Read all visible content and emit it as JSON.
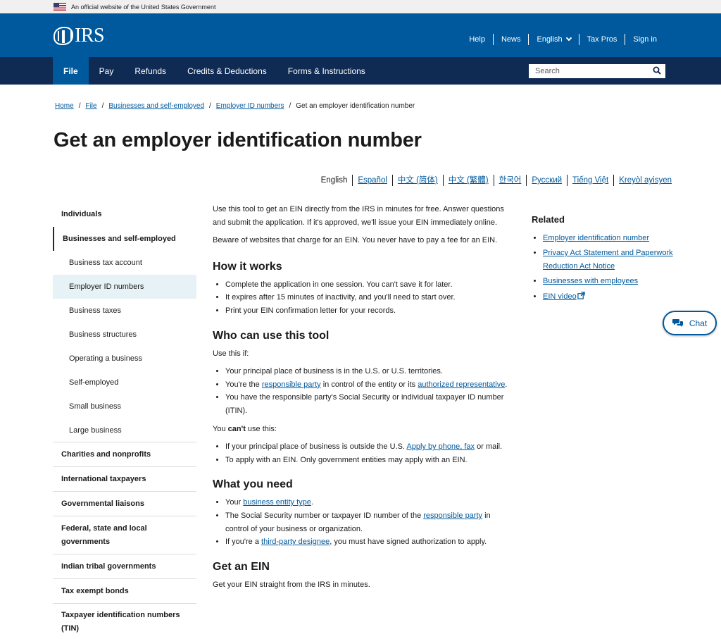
{
  "gov_banner": {
    "text": "An official website of the United States Government"
  },
  "header": {
    "logo_text": "IRS",
    "utility_nav": [
      {
        "label": "Help"
      },
      {
        "label": "News"
      },
      {
        "label": "English"
      },
      {
        "label": "Tax Pros"
      },
      {
        "label": "Sign in"
      }
    ]
  },
  "main_nav": {
    "items": [
      {
        "label": "File"
      },
      {
        "label": "Pay"
      },
      {
        "label": "Refunds"
      },
      {
        "label": "Credits & Deductions"
      },
      {
        "label": "Forms & Instructions"
      }
    ],
    "search_placeholder": "Search"
  },
  "breadcrumb": [
    {
      "label": "Home"
    },
    {
      "label": "File"
    },
    {
      "label": "Businesses and self-employed"
    },
    {
      "label": "Employer ID numbers"
    },
    {
      "label": "Get an employer identification number"
    }
  ],
  "page_title": "Get an employer identification number",
  "languages": [
    "English",
    "Español",
    "中文 (简体)",
    "中文 (繁體)",
    "한국어",
    "Русский",
    "Tiếng Việt",
    "Kreyòl ayisyen"
  ],
  "sidebar": {
    "top1": "Individuals",
    "selected": "Businesses and self-employed",
    "sub": [
      "Business tax account",
      "Employer ID numbers",
      "Business taxes",
      "Business structures",
      "Operating a business",
      "Self-employed",
      "Small business",
      "Large business"
    ],
    "others": [
      "Charities and nonprofits",
      "International taxpayers",
      "Governmental liaisons",
      "Federal, state and local governments",
      "Indian tribal governments",
      "Tax exempt bonds",
      "Taxpayer identification numbers (TIN)"
    ]
  },
  "content": {
    "intro1": "Use this tool to get an EIN directly from the IRS in minutes for free. Answer questions and submit the application. If it's approved, we'll issue your EIN immediately online.",
    "intro2": "Beware of websites that charge for an EIN. You never have to pay a fee for an EIN.",
    "how_title": "How it works",
    "how_items": [
      "Complete the application in one session. You can't save it for later.",
      "It expires after 15 minutes of inactivity, and you'll need to start over.",
      "Print your EIN confirmation letter for your records."
    ],
    "who_title": "Who can use this tool",
    "use_if": "Use this if:",
    "who1": "Your principal place of business is in the U.S. or U.S. territories.",
    "who2_a": "You're the ",
    "who2_link1": "responsible party",
    "who2_b": " in control of the entity or its ",
    "who2_link2": "authorized representative",
    "who2_c": ".",
    "who3": "You have the responsible party's Social Security or individual taxpayer ID number (ITIN).",
    "cant_a": "You ",
    "cant_b": "can't",
    "cant_c": " use this:",
    "cant1_a": "If your principal place of business is outside the U.S. ",
    "cant1_link": "Apply by phone, fax",
    "cant1_b": " or mail.",
    "cant2": "To apply with an EIN. Only government entities may apply with an EIN.",
    "need_title": "What you need",
    "need1_a": "Your ",
    "need1_link": "business entity type",
    "need1_b": ".",
    "need2_a": "The Social Security number or taxpayer ID number of the ",
    "need2_link": "responsible party",
    "need2_b": " in control of your business or organization.",
    "need3_a": "If you're a ",
    "need3_link": "third-party designee",
    "need3_b": ", you must have signed authorization to apply.",
    "get_title": "Get an EIN",
    "get_text": "Get your EIN straight from the IRS in minutes."
  },
  "related": {
    "title": "Related",
    "links": [
      "Employer identification number",
      "Privacy Act Statement and Paperwork Reduction Act Notice",
      "Businesses with employees",
      "EIN video"
    ]
  },
  "chat": {
    "label": "Chat"
  },
  "colors": {
    "header_blue": "#00599c",
    "nav_navy": "#0f2b53",
    "link": "#00599c",
    "sidebar_current": "#e7f2f7"
  }
}
